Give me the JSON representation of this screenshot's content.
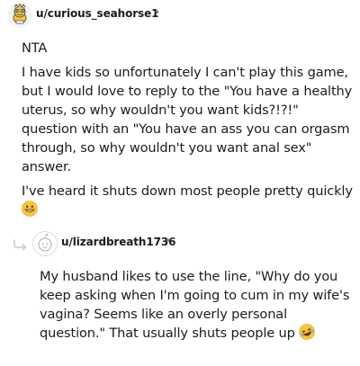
{
  "comments": [
    {
      "username": "u/curious_seahorse1",
      "separator": "•",
      "avatar_icon": "snoo-avatar-icon",
      "paragraphs": [
        "NTA",
        "I have kids so unfortunately I can't play this game, but I would love to reply to the \"You have a healthy uterus, so why wouldn't you want kids?!?!\" question with an \"You have an ass you can orgasm through, so why wouldn't you want anal sex\" answer.",
        "I've heard it shuts down most people pretty quickly"
      ],
      "emoji": "grinning-face-emoji"
    },
    {
      "username": "u/lizardbreath1736",
      "separator": "•",
      "avatar_icon": "default-avatar-icon",
      "reply_icon": "reply-arrow-icon",
      "paragraphs": [
        "My husband likes to use the line, \"Why do you keep asking when I'm going to cum in my wife's vagina? Seems like an overly personal question.\" That usually shuts people up"
      ],
      "emoji": "rolling-laughing-face-emoji"
    }
  ],
  "colors": {
    "text": "#1c1c1c",
    "meta": "#7c7c7c",
    "emoji_yellow": "#f9c440",
    "reply_line": "#c8ccd0"
  }
}
